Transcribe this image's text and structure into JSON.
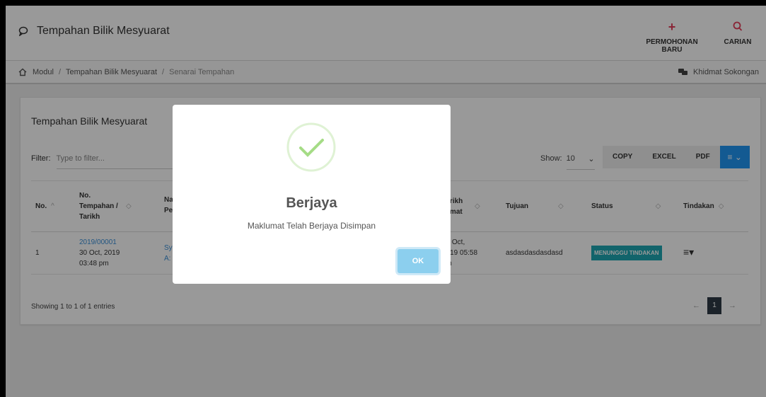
{
  "header": {
    "title": "Tempahan Bilik Mesyuarat",
    "new_request_label": "PERMOHONAN BARU",
    "search_label": "CARIAN",
    "accent_color": "#e53e5b"
  },
  "breadcrumb": {
    "items": [
      "Modul",
      "Tempahan Bilik Mesyuarat",
      "Senarai Tempahan"
    ],
    "separator": "/",
    "support_label": "Khidmat Sokongan"
  },
  "card": {
    "title": "Tempahan Bilik Mesyuarat",
    "filter_label": "Filter:",
    "filter_placeholder": "Type to filter...",
    "show_label": "Show:",
    "show_value": "10",
    "export_buttons": [
      "COPY",
      "EXCEL",
      "PDF"
    ],
    "columns": [
      {
        "label": "No."
      },
      {
        "label": "No. Tempahan / Tarikh"
      },
      {
        "label": "Na Pe"
      },
      {
        "label": "Tarikh Tamat"
      },
      {
        "label": "Tujuan"
      },
      {
        "label": "Status"
      },
      {
        "label": "Tindakan"
      }
    ],
    "rows": [
      {
        "no": "1",
        "booking_no": "2019/00001",
        "booking_date": "30 Oct, 2019",
        "booking_time": "03:48 pm",
        "name_part1": "Sy",
        "name_part2": "A:",
        "end_date": "31 Oct,",
        "end_time": "2019 05:58",
        "end_ampm": "pm",
        "purpose": "asdasdasdasdasd",
        "status": "MENUNGGU TINDAKAN"
      }
    ],
    "info": "Showing 1 to 1 of 1 entries",
    "pager": {
      "prev": "←",
      "current": "1",
      "next": "→"
    },
    "badge_color": "#1ea7b3"
  },
  "modal": {
    "title": "Berjaya",
    "message": "Maklumat Telah Berjaya Disimpan",
    "ok_label": "OK",
    "success_color": "#a5dc86"
  }
}
